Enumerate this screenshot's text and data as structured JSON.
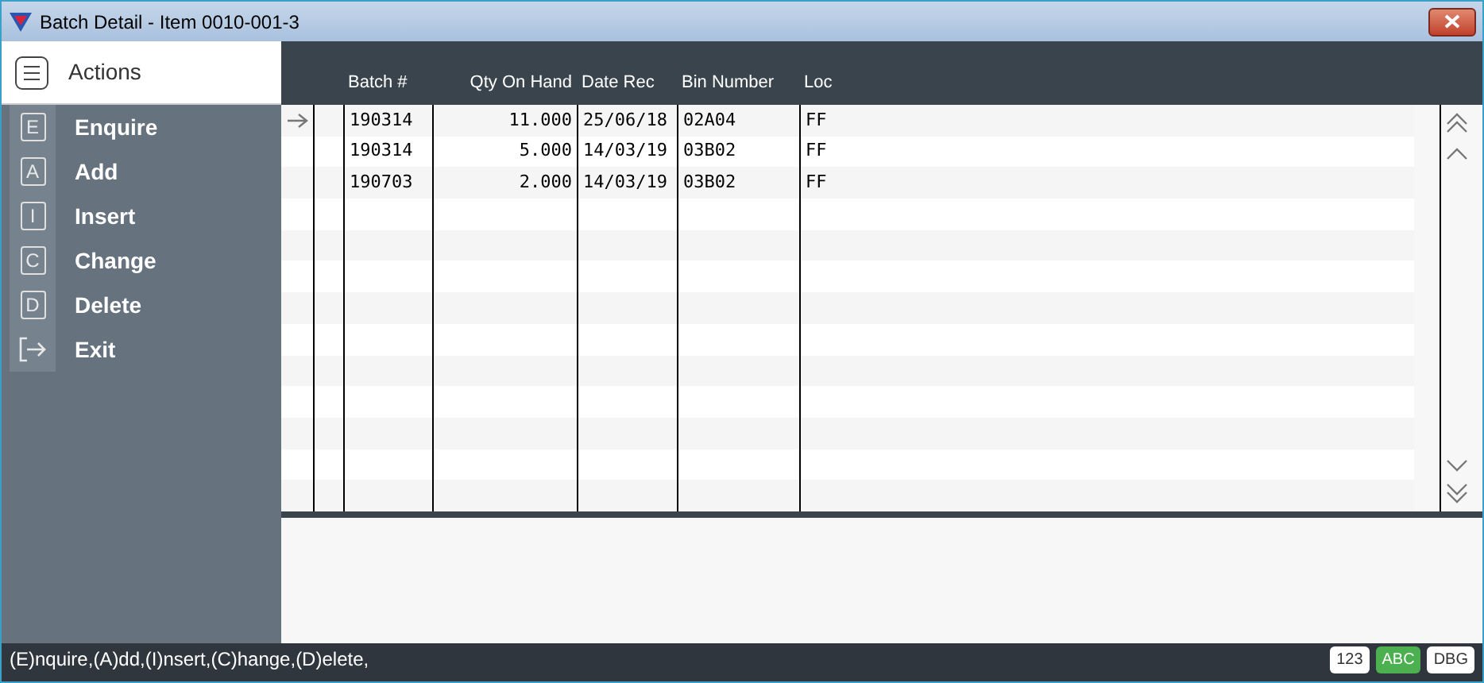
{
  "window": {
    "title": "Batch Detail - Item 0010-001-3"
  },
  "sidebar": {
    "title": "Actions",
    "items": [
      {
        "kind": "key",
        "key": "E",
        "label": "Enquire"
      },
      {
        "kind": "key",
        "key": "A",
        "label": "Add"
      },
      {
        "kind": "key",
        "key": "I",
        "label": "Insert"
      },
      {
        "kind": "key",
        "key": "C",
        "label": "Change"
      },
      {
        "kind": "key",
        "key": "D",
        "label": "Delete"
      },
      {
        "kind": "exit",
        "label": "Exit"
      }
    ]
  },
  "table": {
    "columns": [
      "Batch #",
      "Qty On Hand",
      "Date Rec",
      "Bin Number",
      "Loc"
    ],
    "rows": [
      {
        "current": true,
        "cells": [
          "190314",
          "11.000",
          "25/06/18",
          "02A04",
          "FF"
        ]
      },
      {
        "current": false,
        "cells": [
          "190314",
          "5.000",
          "14/03/19",
          "03B02",
          "FF"
        ]
      },
      {
        "current": false,
        "cells": [
          "190703",
          "2.000",
          "14/03/19",
          "03B02",
          "FF"
        ]
      }
    ]
  },
  "status_bar": {
    "text": "(E)nquire,(A)dd,(I)nsert,(C)hange,(D)elete,",
    "modes": [
      {
        "label": "123",
        "on": false
      },
      {
        "label": "ABC",
        "on": true
      },
      {
        "label": "DBG",
        "on": false
      }
    ]
  }
}
